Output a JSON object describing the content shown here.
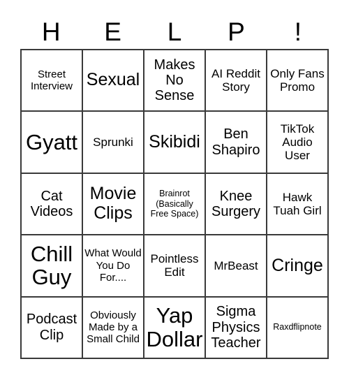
{
  "card": {
    "title_letters": [
      "H",
      "E",
      "L",
      "P",
      "!"
    ],
    "rows": [
      [
        {
          "text": "Street Interview",
          "size": "sm"
        },
        {
          "text": "Sexual",
          "size": "xl"
        },
        {
          "text": "Makes No Sense",
          "size": "lg"
        },
        {
          "text": "AI Reddit Story",
          "size": "md"
        },
        {
          "text": "Only Fans Promo",
          "size": "md"
        }
      ],
      [
        {
          "text": "Gyatt",
          "size": "xxl"
        },
        {
          "text": "Sprunki",
          "size": "md"
        },
        {
          "text": "Skibidi",
          "size": "xl"
        },
        {
          "text": "Ben Shapiro",
          "size": "lg"
        },
        {
          "text": "TikTok Audio User",
          "size": "md"
        }
      ],
      [
        {
          "text": "Cat Videos",
          "size": "lg"
        },
        {
          "text": "Movie Clips",
          "size": "xl"
        },
        {
          "text": "Brainrot (Basically Free Space)",
          "size": "xs"
        },
        {
          "text": "Knee Surgery",
          "size": "lg"
        },
        {
          "text": "Hawk Tuah Girl",
          "size": "md"
        }
      ],
      [
        {
          "text": "Chill Guy",
          "size": "xxl"
        },
        {
          "text": "What Would You Do For....",
          "size": "sm"
        },
        {
          "text": "Pointless Edit",
          "size": "md"
        },
        {
          "text": "MrBeast",
          "size": "md"
        },
        {
          "text": "Cringe",
          "size": "xl"
        }
      ],
      [
        {
          "text": "Podcast Clip",
          "size": "lg"
        },
        {
          "text": "Obviously Made by a Small Child",
          "size": "sm"
        },
        {
          "text": "Yap Dollar",
          "size": "xxl"
        },
        {
          "text": "Sigma Physics Teacher",
          "size": "lg"
        },
        {
          "text": "Raxdflipnote",
          "size": "xs"
        }
      ]
    ]
  },
  "colors": {
    "background": "#ffffff",
    "grid_line": "#3a3a3a",
    "text": "#000000"
  }
}
